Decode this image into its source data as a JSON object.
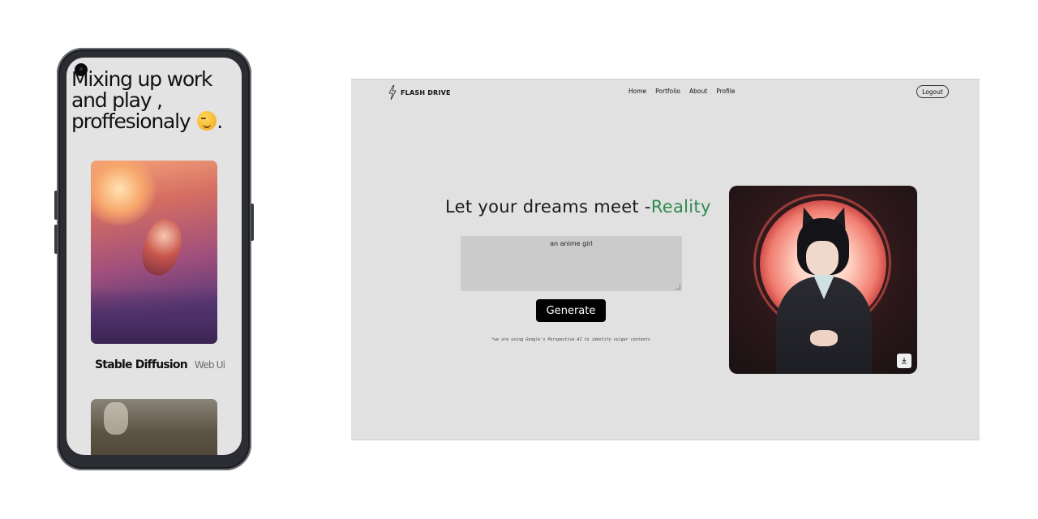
{
  "mobile": {
    "headline_lines": [
      "Mixing up work",
      "and play ,",
      "proffesionaly"
    ],
    "headline_end": ".",
    "emoji_icon": "winking-face-emoji",
    "card_title": "Stable Diffusion",
    "card_subtitle": "Web Ui"
  },
  "desktop": {
    "brand": "FLASH DRIVE",
    "logo_icon": "lightning-bolt-icon",
    "nav": [
      "Home",
      "Portfolio",
      "About",
      "Profile"
    ],
    "logout_label": "Logout",
    "hero_title": "Let your dreams meet -",
    "hero_accent": "Reality",
    "prompt_value": "an anime girl",
    "generate_label": "Generate",
    "note": "*we are using Google's Perspective AI to identify vulgar contents",
    "download_icon": "download-icon",
    "colors": {
      "accent": "#2e8b4e",
      "background": "#e1e1e1",
      "button": "#000000"
    }
  }
}
